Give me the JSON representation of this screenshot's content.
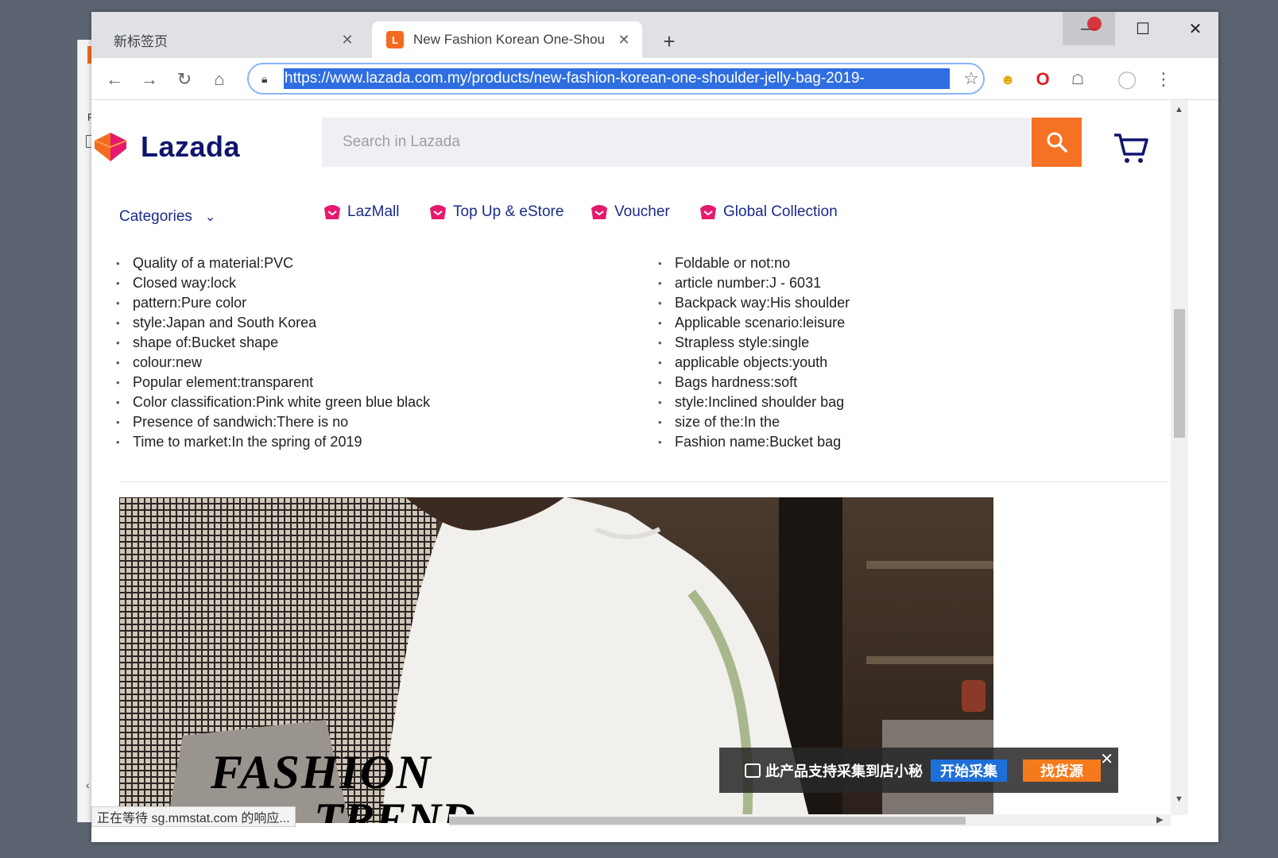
{
  "tabs": [
    {
      "title": "新标签页",
      "active": false
    },
    {
      "title": "New Fashion Korean One-Shou",
      "active": true
    }
  ],
  "address": {
    "url": "https://www.lazada.com.my/products/new-fashion-korean-one-shoulder-jelly-bag-2019-"
  },
  "site": {
    "logo_text": "Lazada",
    "search_placeholder": "Search in Lazada",
    "categories_label": "Categories",
    "nav": [
      "LazMall",
      "Top Up & eStore",
      "Voucher",
      "Global Collection"
    ]
  },
  "specs_left": [
    "Quality of a material:PVC",
    "Closed way:lock",
    "pattern:Pure color",
    "style:Japan and South Korea",
    "shape of:Bucket shape",
    "colour:new",
    "Popular element:transparent",
    "Color classification:Pink white green blue black",
    "Presence of sandwich:There is no",
    "Time to market:In the spring of 2019"
  ],
  "specs_right": [
    "Foldable or not:no",
    "article number:J - 6031",
    "Backpack way:His shoulder",
    "Applicable scenario:leisure",
    "Strapless style:single",
    "applicable objects:youth",
    "Bags hardness:soft",
    "style:Inclined shoulder bag",
    "size of the:In the",
    "Fashion name:Bucket bag"
  ],
  "image_text": {
    "line1": "FASHION",
    "line2": "TREND"
  },
  "status_text": "正在等待 sg.mmstat.com 的响应...",
  "popup": {
    "message": "此产品支持采集到店小秘",
    "btn_collect": "开始采集",
    "btn_source": "找货源"
  },
  "colors": {
    "brand_orange": "#f57224",
    "brand_navy": "#0f146d",
    "selection_blue": "#2f6ee0"
  }
}
